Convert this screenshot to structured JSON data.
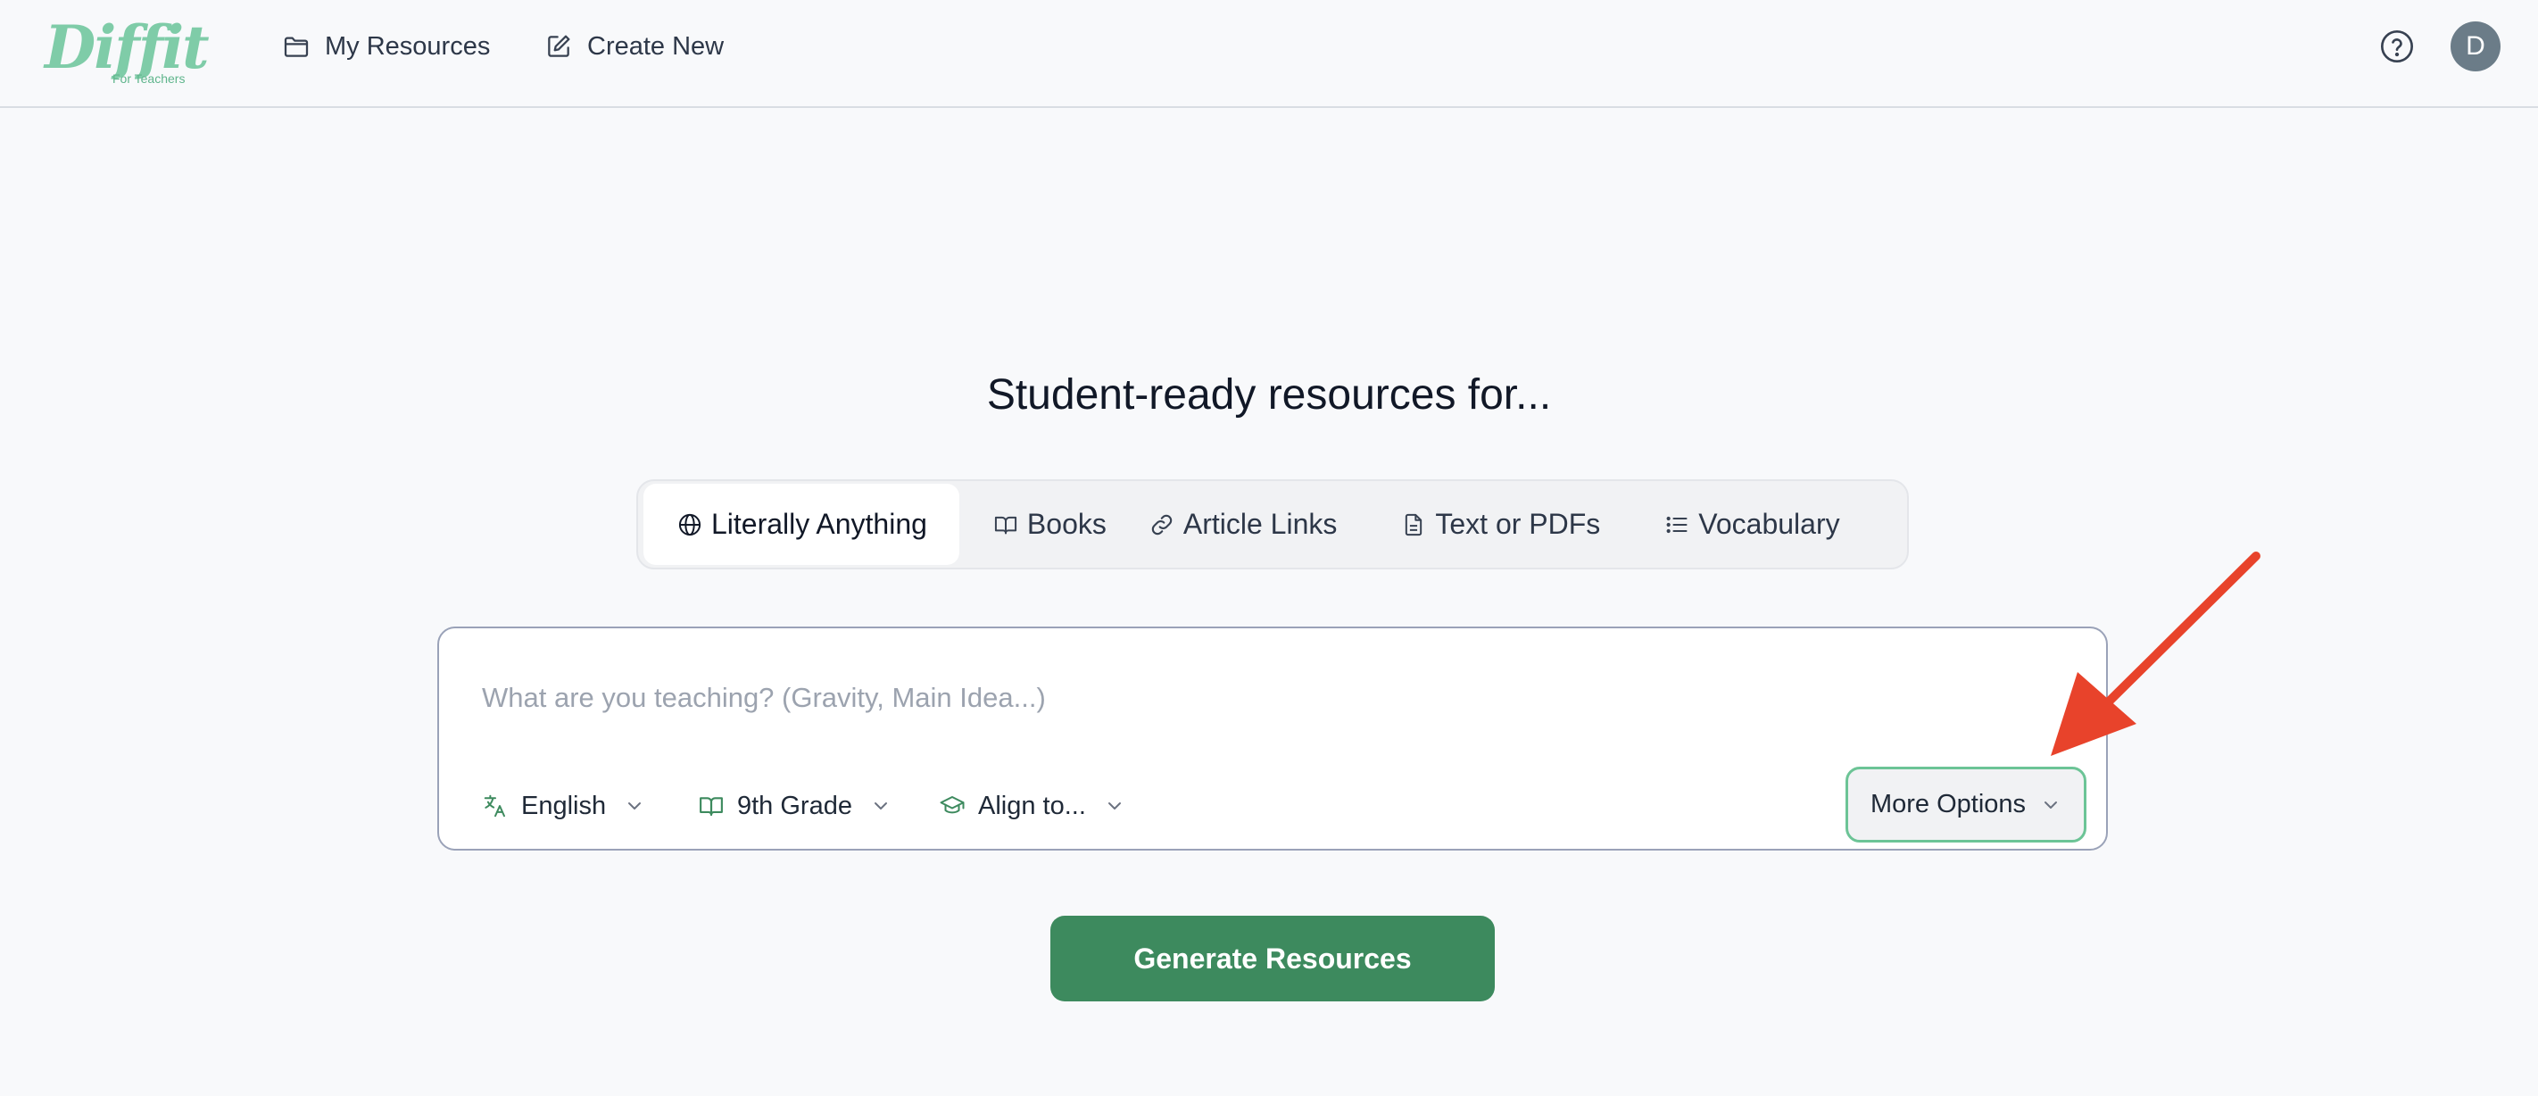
{
  "brand": {
    "logo_text": "Diffit",
    "logo_subtext": "For Teachers",
    "accent_color": "#7fcca8"
  },
  "nav": {
    "items": [
      {
        "label": "My Resources",
        "icon": "folder-icon"
      },
      {
        "label": "Create New",
        "icon": "edit-icon"
      }
    ]
  },
  "header_right": {
    "help_icon": "help-circle-icon",
    "avatar_initial": "D"
  },
  "main": {
    "title": "Student-ready resources for...",
    "tabs": [
      {
        "label": "Literally Anything",
        "icon": "globe-icon",
        "active": true
      },
      {
        "label": "Books",
        "icon": "book-open-icon",
        "active": false
      },
      {
        "label": "Article Links",
        "icon": "link-icon",
        "active": false
      },
      {
        "label": "Text or PDFs",
        "icon": "file-text-icon",
        "active": false
      },
      {
        "label": "Vocabulary",
        "icon": "list-icon",
        "active": false
      }
    ],
    "prompt": {
      "placeholder": "What are you teaching? (Gravity, Main Idea...)",
      "value": ""
    },
    "options": {
      "language": {
        "label": "English",
        "icon": "translate-icon"
      },
      "grade": {
        "label": "9th Grade",
        "icon": "book-icon"
      },
      "align": {
        "label": "Align to...",
        "icon": "graduation-cap-icon"
      },
      "more": {
        "label": "More Options",
        "icon": "chevron-down-icon"
      }
    },
    "generate_label": "Generate Resources",
    "button_color": "#3d8a5e"
  },
  "annotation": {
    "arrow_icon": "red-arrow-annotation",
    "arrow_color": "#e8432b"
  }
}
